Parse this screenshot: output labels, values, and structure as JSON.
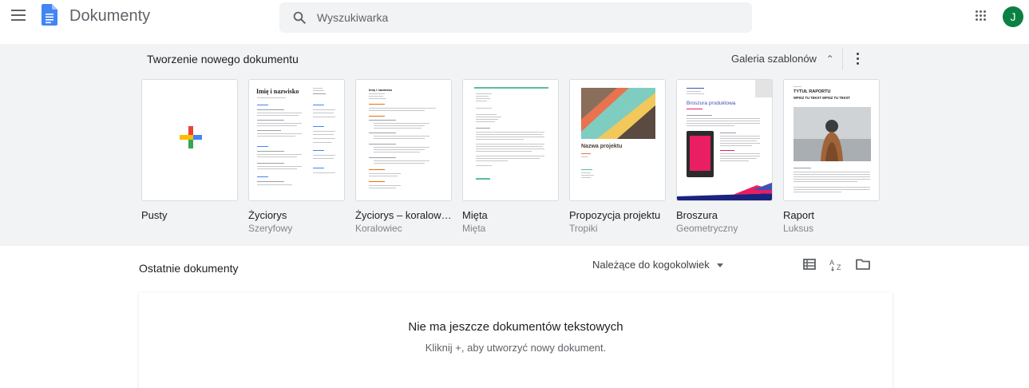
{
  "header": {
    "app_title": "Dokumenty",
    "search_placeholder": "Wyszukiwarka",
    "avatar_initial": "J",
    "avatar_color": "#0b8043",
    "docs_logo_color": "#4285f4"
  },
  "templates": {
    "section_title": "Tworzenie nowego dokumentu",
    "gallery_label": "Galeria szablonów",
    "items": [
      {
        "name": "Pusty",
        "subtitle": ""
      },
      {
        "name": "Życiorys",
        "subtitle": "Szeryfowy",
        "thumb_heading": "Imię i nazwisko"
      },
      {
        "name": "Życiorys – koralowi...",
        "subtitle": "Koralowiec",
        "thumb_heading": "Imię i nazwisko"
      },
      {
        "name": "Mięta",
        "subtitle": "Mięta"
      },
      {
        "name": "Propozycja projektu",
        "subtitle": "Tropiki",
        "thumb_heading": "Nazwa projektu"
      },
      {
        "name": "Broszura",
        "subtitle": "Geometryczny",
        "thumb_heading": "Broszura produktowa"
      },
      {
        "name": "Raport",
        "subtitle": "Luksus",
        "thumb_heading": "TYTUŁ RAPORTU",
        "thumb_subheading": "WPISZ TU TEKST WPISZ TU TEKST"
      }
    ]
  },
  "recent": {
    "title": "Ostatnie dokumenty",
    "owner_filter": "Należące do kogokolwiek",
    "empty_title": "Nie ma jeszcze dokumentów tekstowych",
    "empty_subtitle": "Kliknij +, aby utworzyć nowy dokument."
  }
}
